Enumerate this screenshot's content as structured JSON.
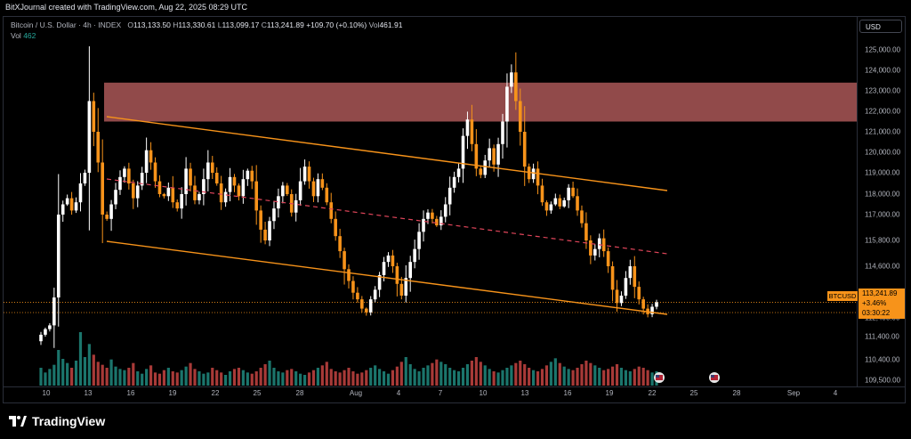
{
  "header": {
    "text": "BitXJournal created with TradingView.com, Aug 22, 2025 08:29 UTC"
  },
  "legend": {
    "symbol": "Bitcoin / U.S. Dollar · 4h · INDEX",
    "o_label": "O",
    "o": "113,133.50",
    "h_label": "H",
    "h": "113,330.61",
    "l_label": "L",
    "l": "113,099.17",
    "c_label": "C",
    "c": "113,241.89",
    "change": "+109.70 (+0.10%)",
    "vol_label": "Vol",
    "vol": "461.91",
    "vol2_label": "Vol",
    "vol2": "462"
  },
  "currency_button": "USD",
  "price_tag": {
    "symbol": "BTCUSD",
    "price": "113,241.89",
    "change": "+3.46%",
    "countdown": "03:30:22"
  },
  "brand": {
    "name": "TradingView"
  },
  "colors": {
    "up": "#ffffff",
    "down": "#f7931a",
    "channel": "#f7931a",
    "zone": "#c9666680",
    "midline": "#e0455a",
    "vol_up": "#26a69a",
    "vol_down": "#ef5350"
  },
  "icons": [
    "us-flag-event-icon",
    "us-flag-event-icon"
  ],
  "chart_data": {
    "type": "candlestick",
    "title": "",
    "y_ticks": [
      109500,
      110400,
      111400,
      112400,
      113600,
      114600,
      115800,
      117000,
      118000,
      119000,
      120000,
      121000,
      122000,
      123000,
      124000,
      125000
    ],
    "y_tick_labels": [
      "109,500.00",
      "110,400.00",
      "111,400.00",
      "112,400.00",
      "113,600.00",
      "114,600.00",
      "115,800.00",
      "117,000.00",
      "118,000.00",
      "119,000.00",
      "120,000.00",
      "121,000.00",
      "122,000.00",
      "123,000.00",
      "124,000.00",
      "125,000.00"
    ],
    "x_tick_labels": [
      "10",
      "13",
      "16",
      "19",
      "22",
      "25",
      "28",
      "Aug",
      "4",
      "7",
      "10",
      "13",
      "16",
      "19",
      "22",
      "25",
      "28",
      "Sep",
      "4"
    ],
    "current_price": 113241.89,
    "resistance_zone": [
      121500,
      123400
    ],
    "channel": {
      "upper": [
        [
          "Jul 14",
          121700
        ],
        [
          "Aug 24",
          118200
        ]
      ],
      "lower": [
        [
          "Jul 14",
          115400
        ],
        [
          "Aug 24",
          112700
        ]
      ],
      "mid": [
        [
          "Jul 14",
          118600
        ],
        [
          "Aug 24",
          115400
        ]
      ]
    },
    "close_series": [
      111500,
      111800,
      112000,
      113500,
      117000,
      117500,
      117800,
      117200,
      117600,
      118500,
      119000,
      122500,
      121000,
      119500,
      117000,
      116800,
      117500,
      118200,
      118800,
      119200,
      118500,
      117800,
      118400,
      119000,
      120100,
      119500,
      118600,
      118000,
      117900,
      118300,
      117600,
      117300,
      118000,
      119200,
      118400,
      117700,
      118000,
      118700,
      119500,
      119000,
      118500,
      117600,
      118100,
      118800,
      118400,
      117900,
      118700,
      119100,
      118600,
      117200,
      116300,
      115800,
      116700,
      117300,
      117900,
      118400,
      118000,
      117100,
      117700,
      118600,
      119300,
      118600,
      117900,
      118700,
      118300,
      117600,
      116800,
      116000,
      115300,
      114500,
      114100,
      113700,
      113400,
      112900,
      112700,
      113400,
      113800,
      114300,
      114800,
      115100,
      114600,
      114000,
      113600,
      114200,
      114800,
      115400,
      116200,
      116800,
      117100,
      116800,
      116500,
      116900,
      117500,
      118300,
      118800,
      119200,
      120800,
      121600,
      120400,
      119200,
      118900,
      119600,
      120200,
      119400,
      120400,
      121500,
      123200,
      123900,
      122500,
      121000,
      119300,
      118700,
      119200,
      118400,
      117600,
      117200,
      117500,
      117800,
      117400,
      117700,
      118300,
      117900,
      117200,
      116600,
      115800,
      115100,
      115400,
      115900,
      115300,
      114600,
      113800,
      113200,
      113600,
      114200,
      114600,
      113900,
      113400,
      112900,
      112600,
      113000,
      113242
    ],
    "volume_series": [
      30,
      22,
      28,
      35,
      60,
      45,
      38,
      30,
      42,
      90,
      48,
      70,
      52,
      40,
      35,
      30,
      44,
      32,
      28,
      26,
      30,
      38,
      24,
      20,
      28,
      34,
      22,
      20,
      26,
      30,
      24,
      22,
      26,
      32,
      38,
      28,
      24,
      20,
      22,
      30,
      26,
      22,
      18,
      24,
      28,
      30,
      26,
      22,
      20,
      24,
      30,
      36,
      42,
      30,
      24,
      22,
      26,
      28,
      24,
      20,
      18,
      22,
      26,
      30,
      34,
      40,
      28,
      24,
      22,
      26,
      30,
      24,
      20,
      22,
      26,
      30,
      34,
      28,
      24,
      20,
      26,
      32,
      40,
      48,
      36,
      28,
      24,
      30,
      34,
      38,
      44,
      40,
      36,
      30,
      26,
      24,
      30,
      36,
      42,
      48,
      40,
      34,
      28,
      24,
      22,
      26,
      30,
      34,
      38,
      42,
      36,
      30,
      26,
      24,
      28,
      34,
      40,
      46,
      38,
      32,
      28,
      26,
      30,
      36,
      42,
      38,
      34,
      30,
      26,
      28,
      32,
      36,
      30,
      26,
      24,
      28,
      32,
      30,
      26,
      22,
      24
    ]
  }
}
